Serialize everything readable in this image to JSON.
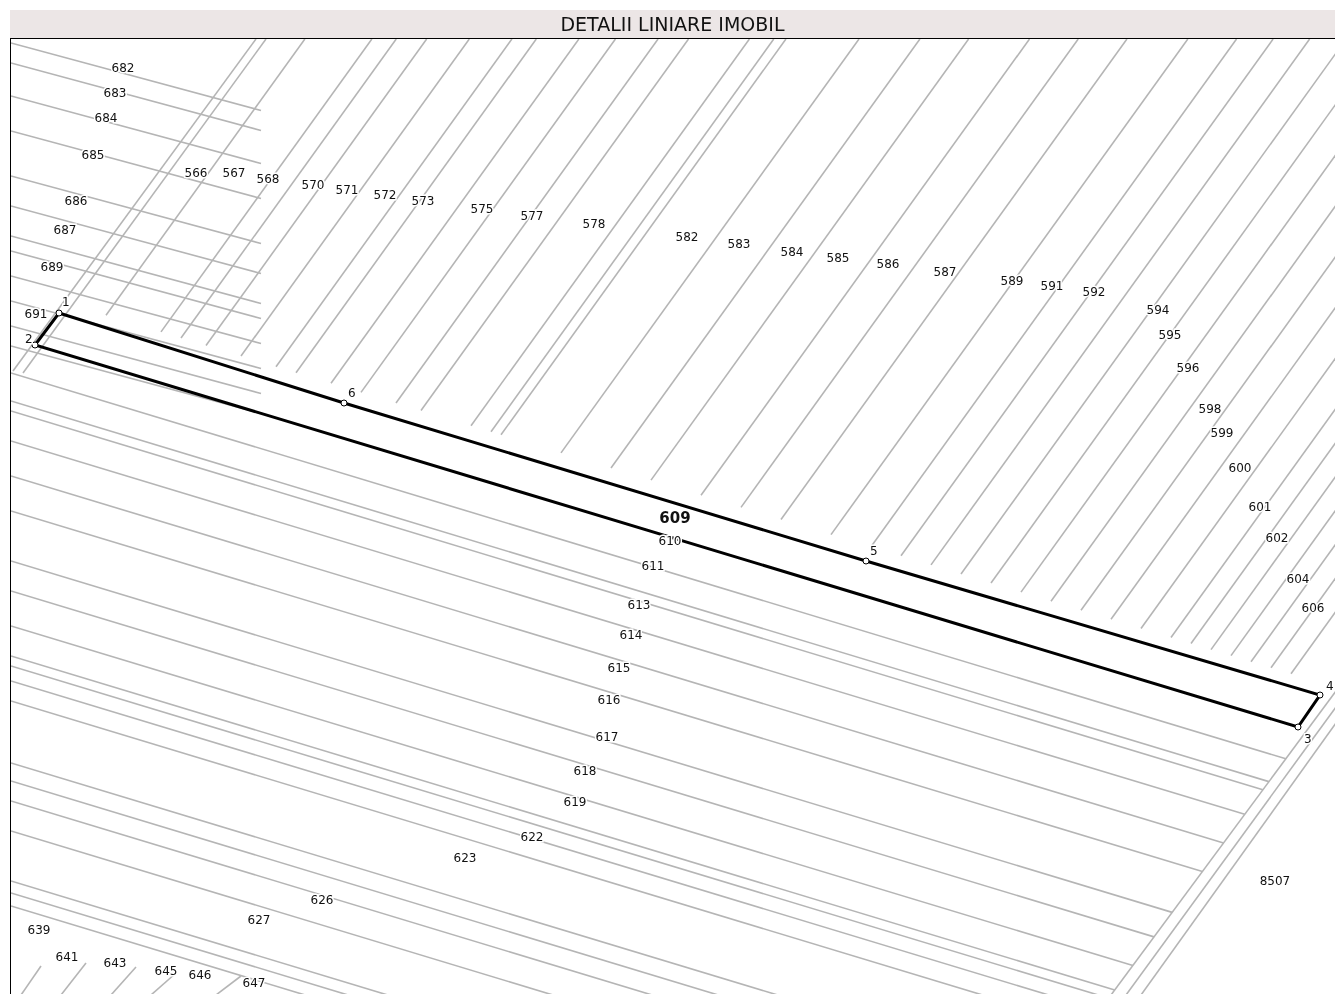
{
  "title": "DETALII LINIARE IMOBIL",
  "parcel": {
    "number": "609",
    "vertices": [
      "1",
      "2",
      "3",
      "4",
      "5",
      "6"
    ]
  },
  "parcel_numbers": [
    "682",
    "683",
    "684",
    "685",
    "686",
    "687",
    "689",
    "691",
    "566",
    "567",
    "568",
    "570",
    "571",
    "572",
    "573",
    "575",
    "577",
    "578",
    "582",
    "583",
    "584",
    "585",
    "586",
    "587",
    "589",
    "591",
    "592",
    "594",
    "595",
    "596",
    "598",
    "599",
    "600",
    "601",
    "602",
    "604",
    "606",
    "610",
    "611",
    "613",
    "614",
    "615",
    "616",
    "617",
    "618",
    "619",
    "622",
    "623",
    "626",
    "627",
    "639",
    "641",
    "643",
    "645",
    "646",
    "647",
    "8507"
  ]
}
